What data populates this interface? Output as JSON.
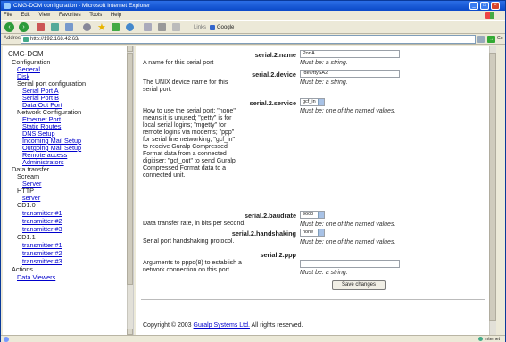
{
  "window": {
    "title": "CMG-DCM configuration - Microsoft Internet Explorer"
  },
  "menu": [
    "File",
    "Edit",
    "View",
    "Favorites",
    "Tools",
    "Help"
  ],
  "toolbar": {
    "links_label": "Links",
    "google_label": "Google"
  },
  "address": {
    "label": "Address",
    "url": "http://192.168.42.63/",
    "go_label": "Go"
  },
  "nav": {
    "root": "CMG-DCM",
    "configuration": "Configuration",
    "general": "General",
    "disk": "Disk",
    "serial_config": "Serial port configuration",
    "serial_a": "Serial Port A",
    "serial_b": "Serial Port B",
    "data_out": "Data Out Port",
    "network": "Network Configuration",
    "ethernet": "Ethernet Port",
    "static_routes": "Static Routes",
    "dns": "DNS Setup",
    "incoming_mail": "Incoming Mail Setup",
    "outgoing_mail": "Outgoing Mail Setup",
    "remote": "Remote access",
    "admins": "Administrators",
    "data_transfer": "Data transfer",
    "scream": "Scream",
    "server": "Server",
    "http": "HTTP",
    "http_server": "server",
    "cd10": "CD1.0",
    "t1": "transmitter #1",
    "t2": "transmitter #2",
    "t3": "transmitter #3",
    "cd11": "CD1.1",
    "t11": "transmitter #1",
    "t12": "transmitter #2",
    "t13": "transmitter #3",
    "actions": "Actions",
    "viewers": "Data Viewers"
  },
  "form": {
    "name": {
      "label": "serial.2.name",
      "desc": "A name for this serial port",
      "value": "PortA",
      "hint": "Must be: a string."
    },
    "device": {
      "label": "serial.2.device",
      "desc": "The UNIX device name for this serial port.",
      "value": "/dev/ttySA2",
      "hint": "Must be: a string."
    },
    "service": {
      "label": "serial.2.service",
      "desc": "How to use the serial port: \"none\" means it is unused; \"getty\" is for local serial logins; \"mgetty\" for remote logins via modems; \"ppp\" for serial line networking; \"gcf_in\" to receive Guralp Compressed Format data from a connected digitiser; \"gcf_out\" to send Guralp Compressed Format data to a connected unit.",
      "value": "gcf_in",
      "hint": "Must be: one of the named values."
    },
    "baudrate": {
      "label": "serial.2.baudrate",
      "desc": "Data transfer rate, in bits per second.",
      "value": "9600",
      "hint": "Must be: one of the named values."
    },
    "handshaking": {
      "label": "serial.2.handshaking",
      "desc": "Serial port handshaking protocol.",
      "value": "none",
      "hint": "Must be: one of the named values."
    },
    "ppp": {
      "label": "serial.2.ppp",
      "desc": "Arguments to pppd(8) to establish a network connection on this port.",
      "value": "",
      "hint": "Must be: a string."
    },
    "save_label": "Save changes"
  },
  "footer": {
    "prefix": "Copyright © 2003 ",
    "link": "Guralp Systems Ltd.",
    "suffix": " All rights reserved."
  },
  "status": {
    "zone": "Internet"
  }
}
